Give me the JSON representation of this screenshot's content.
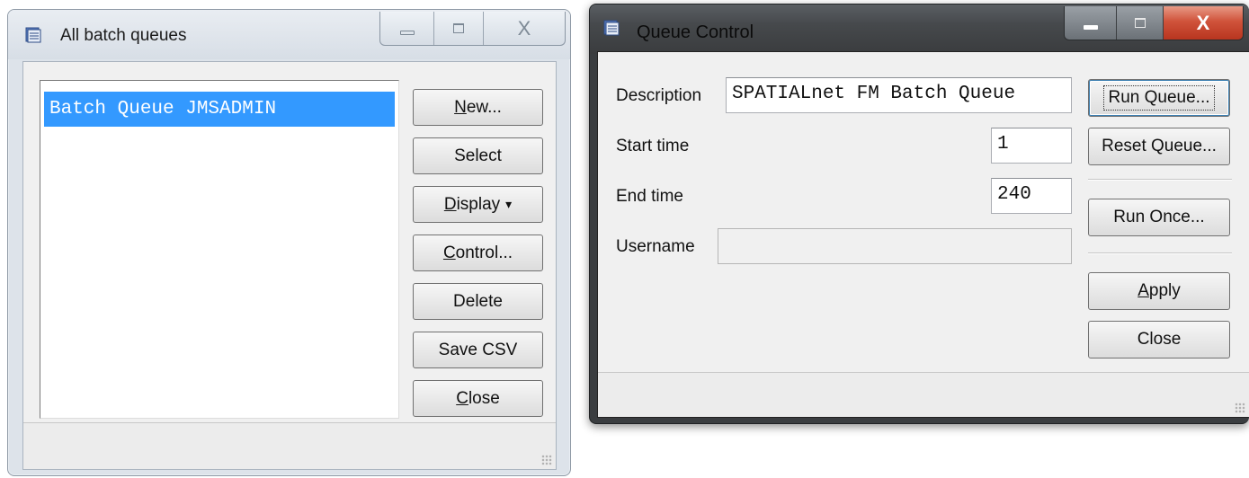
{
  "left_window": {
    "title": "All batch queues",
    "list_items": [
      "Batch Queue JMSADMIN"
    ],
    "buttons": {
      "new_u": "N",
      "new_rest": "ew...",
      "select": "Select",
      "display_u": "D",
      "display_rest": "isplay",
      "display_arrow": "▾",
      "control_u": "C",
      "control_rest": "ontrol...",
      "delete": "Delete",
      "save_csv": "Save CSV",
      "close_u": "C",
      "close_rest": "lose"
    }
  },
  "right_window": {
    "title": "Queue Control",
    "labels": {
      "description": "Description",
      "start_time": "Start time",
      "end_time": "End time",
      "username": "Username"
    },
    "fields": {
      "description": "SPATIALnet FM Batch Queue",
      "start_time": "1",
      "end_time": "240",
      "username": ""
    },
    "buttons": {
      "run_queue": "Run Queue...",
      "reset_queue": "Reset Queue...",
      "run_once": "Run Once...",
      "apply_u": "A",
      "apply_rest": "pply",
      "close": "Close"
    }
  },
  "caption": {
    "close_glyph": "X"
  }
}
